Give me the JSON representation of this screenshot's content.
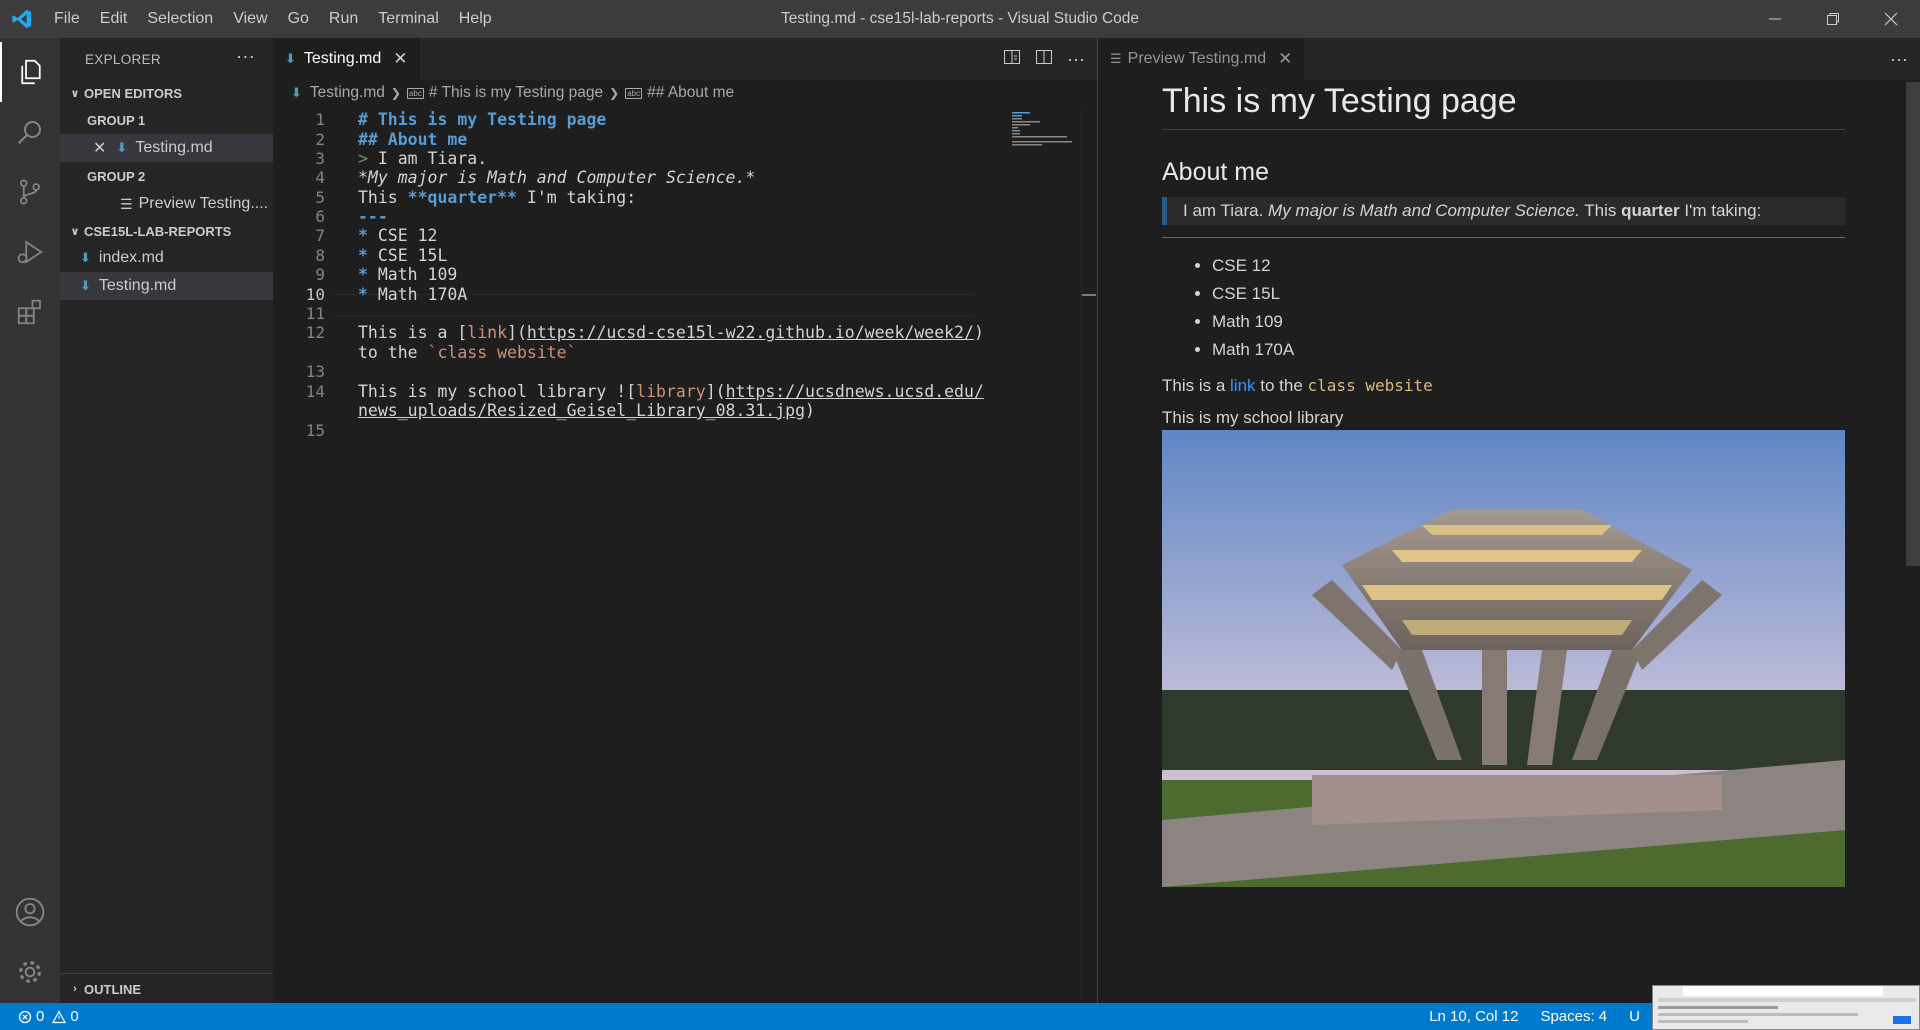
{
  "titlebar": {
    "menus": [
      "File",
      "Edit",
      "Selection",
      "View",
      "Go",
      "Run",
      "Terminal",
      "Help"
    ],
    "title": "Testing.md - cse15l-lab-reports - Visual Studio Code",
    "controls": [
      "minimize-icon",
      "restore-icon",
      "close-icon"
    ]
  },
  "activitybar": {
    "items": [
      "explorer-icon",
      "search-icon",
      "source-control-icon",
      "run-debug-icon",
      "extensions-icon"
    ],
    "bottom": [
      "accounts-icon",
      "settings-gear-icon"
    ]
  },
  "sidebar": {
    "header": "EXPLORER",
    "open_editors": "OPEN EDITORS",
    "group1": "GROUP 1",
    "group1_file": "Testing.md",
    "group2": "GROUP 2",
    "group2_file": "Preview Testing....",
    "folder": "CSE15L-LAB-REPORTS",
    "files": [
      "index.md",
      "Testing.md"
    ],
    "outline": "OUTLINE"
  },
  "editor": {
    "tab": "Testing.md",
    "breadcrumb": [
      "Testing.md",
      "# This is my Testing page",
      "## About me"
    ],
    "lines": {
      "l1": "# This is my Testing page",
      "l2": "## About me",
      "l3_mark": ">",
      "l3_text": " I am Tiara.",
      "l4": "*My major is Math and Computer Science.*",
      "l5_a": "This ",
      "l5_b": "**quarter**",
      "l5_c": " I'm taking:",
      "l6": "---",
      "l7_b": "*",
      "l7": " CSE 12",
      "l8": " CSE 15L",
      "l9": " Math 109",
      "l10": " Math 170A",
      "l12_a": "This is a [",
      "l12_b": "link",
      "l12_c": "](",
      "l12_url": "https://ucsd-cse15l-w22.github.io/week/week2/",
      "l12_d": ")",
      "l12_e": "to the ",
      "l12_code": "`class website`",
      "l14_a": "This is my school library ![",
      "l14_b": "library",
      "l14_c": "](",
      "l14_url1": "https://ucsdnews.ucsd.edu/",
      "l14_url2": "news_uploads/Resized_Geisel_Library_08.31.jpg",
      "l14_d": ")"
    },
    "line_numbers": [
      "1",
      "2",
      "3",
      "4",
      "5",
      "6",
      "7",
      "8",
      "9",
      "10",
      "11",
      "12",
      "",
      "13",
      "14",
      "",
      "15"
    ]
  },
  "preview": {
    "tab": "Preview Testing.md",
    "h1": "This is my Testing page",
    "h2": "About me",
    "quote_a": "I am Tiara. ",
    "quote_em": "My major is Math and Computer Science.",
    "quote_b": " This ",
    "quote_strong": "quarter",
    "quote_c": " I'm taking:",
    "list": [
      "CSE 12",
      "CSE 15L",
      "Math 109",
      "Math 170A"
    ],
    "p1_a": "This is a ",
    "p1_link": "link",
    "p1_b": " to the ",
    "p1_code": "class website",
    "p2": "This is my school library"
  },
  "statusbar": {
    "errors": "0",
    "warnings": "0",
    "position": "Ln 10, Col 12",
    "spaces": "Spaces: 4",
    "encoding_partial": "U"
  },
  "colors": {
    "accent": "#007acc",
    "heading": "#569cd6",
    "link_string": "#ce9178",
    "md_icon": "#519aba"
  }
}
